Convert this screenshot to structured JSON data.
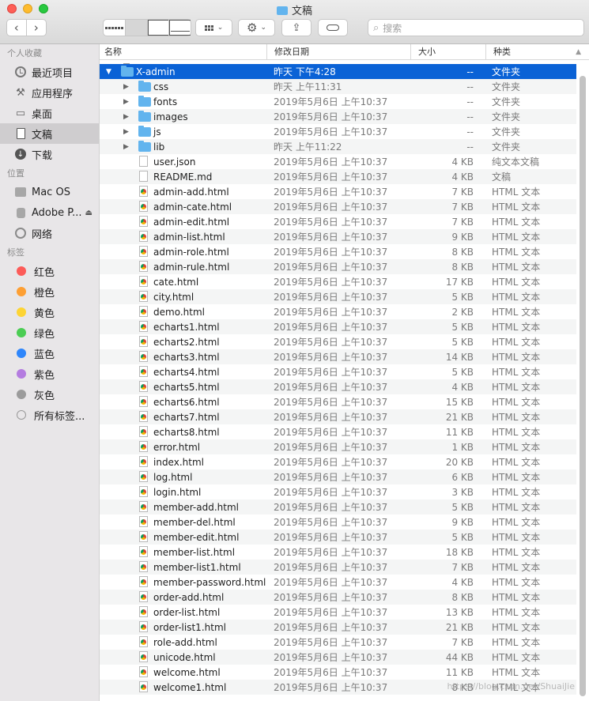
{
  "window": {
    "title": "文稿"
  },
  "toolbar": {
    "search_placeholder": "搜索"
  },
  "sidebar": {
    "sections": [
      {
        "title": "个人收藏",
        "items": [
          {
            "label": "最近项目",
            "icon": "recents-clock-icon"
          },
          {
            "label": "应用程序",
            "icon": "applications-icon"
          },
          {
            "label": "桌面",
            "icon": "desktop-icon"
          },
          {
            "label": "文稿",
            "icon": "documents-icon",
            "selected": true
          },
          {
            "label": "下载",
            "icon": "downloads-icon"
          }
        ]
      },
      {
        "title": "位置",
        "items": [
          {
            "label": "Mac OS",
            "icon": "hard-disk-icon"
          },
          {
            "label": "Adobe P...",
            "icon": "external-disk-icon"
          },
          {
            "label": "网络",
            "icon": "network-globe-icon"
          }
        ]
      },
      {
        "title": "标签",
        "items": [
          {
            "label": "红色",
            "color": "#fc5b58"
          },
          {
            "label": "橙色",
            "color": "#fd9f33"
          },
          {
            "label": "黄色",
            "color": "#fdd434"
          },
          {
            "label": "绿色",
            "color": "#4bcd53"
          },
          {
            "label": "蓝色",
            "color": "#2e86fb"
          },
          {
            "label": "紫色",
            "color": "#b47ce0"
          },
          {
            "label": "灰色",
            "color": "#9b9b9b"
          },
          {
            "label": "所有标签...",
            "color": ""
          }
        ]
      }
    ]
  },
  "columns": {
    "name": "名称",
    "date": "修改日期",
    "size": "大小",
    "kind": "种类"
  },
  "files": [
    {
      "name": "X-admin",
      "date": "昨天 下午4:28",
      "size": "--",
      "kind": "文件夹",
      "type": "folder",
      "level": 0,
      "expanded": true,
      "selected": true
    },
    {
      "name": "css",
      "date": "昨天 上午11:31",
      "size": "--",
      "kind": "文件夹",
      "type": "folder",
      "level": 1
    },
    {
      "name": "fonts",
      "date": "2019年5月6日 上午10:37",
      "size": "--",
      "kind": "文件夹",
      "type": "folder",
      "level": 1
    },
    {
      "name": "images",
      "date": "2019年5月6日 上午10:37",
      "size": "--",
      "kind": "文件夹",
      "type": "folder",
      "level": 1
    },
    {
      "name": "js",
      "date": "2019年5月6日 上午10:37",
      "size": "--",
      "kind": "文件夹",
      "type": "folder",
      "level": 1
    },
    {
      "name": "lib",
      "date": "昨天 上午11:22",
      "size": "--",
      "kind": "文件夹",
      "type": "folder",
      "level": 1
    },
    {
      "name": "user.json",
      "date": "2019年5月6日 上午10:37",
      "size": "4 KB",
      "kind": "纯文本文稿",
      "type": "file",
      "level": 1
    },
    {
      "name": "README.md",
      "date": "2019年5月6日 上午10:37",
      "size": "4 KB",
      "kind": "文稿",
      "type": "file",
      "level": 1
    },
    {
      "name": "admin-add.html",
      "date": "2019年5月6日 上午10:37",
      "size": "7 KB",
      "kind": "HTML 文本",
      "type": "html",
      "level": 1
    },
    {
      "name": "admin-cate.html",
      "date": "2019年5月6日 上午10:37",
      "size": "7 KB",
      "kind": "HTML 文本",
      "type": "html",
      "level": 1
    },
    {
      "name": "admin-edit.html",
      "date": "2019年5月6日 上午10:37",
      "size": "7 KB",
      "kind": "HTML 文本",
      "type": "html",
      "level": 1
    },
    {
      "name": "admin-list.html",
      "date": "2019年5月6日 上午10:37",
      "size": "9 KB",
      "kind": "HTML 文本",
      "type": "html",
      "level": 1
    },
    {
      "name": "admin-role.html",
      "date": "2019年5月6日 上午10:37",
      "size": "8 KB",
      "kind": "HTML 文本",
      "type": "html",
      "level": 1
    },
    {
      "name": "admin-rule.html",
      "date": "2019年5月6日 上午10:37",
      "size": "8 KB",
      "kind": "HTML 文本",
      "type": "html",
      "level": 1
    },
    {
      "name": "cate.html",
      "date": "2019年5月6日 上午10:37",
      "size": "17 KB",
      "kind": "HTML 文本",
      "type": "html",
      "level": 1
    },
    {
      "name": "city.html",
      "date": "2019年5月6日 上午10:37",
      "size": "5 KB",
      "kind": "HTML 文本",
      "type": "html",
      "level": 1
    },
    {
      "name": "demo.html",
      "date": "2019年5月6日 上午10:37",
      "size": "2 KB",
      "kind": "HTML 文本",
      "type": "html",
      "level": 1
    },
    {
      "name": "echarts1.html",
      "date": "2019年5月6日 上午10:37",
      "size": "5 KB",
      "kind": "HTML 文本",
      "type": "html",
      "level": 1
    },
    {
      "name": "echarts2.html",
      "date": "2019年5月6日 上午10:37",
      "size": "5 KB",
      "kind": "HTML 文本",
      "type": "html",
      "level": 1
    },
    {
      "name": "echarts3.html",
      "date": "2019年5月6日 上午10:37",
      "size": "14 KB",
      "kind": "HTML 文本",
      "type": "html",
      "level": 1
    },
    {
      "name": "echarts4.html",
      "date": "2019年5月6日 上午10:37",
      "size": "5 KB",
      "kind": "HTML 文本",
      "type": "html",
      "level": 1
    },
    {
      "name": "echarts5.html",
      "date": "2019年5月6日 上午10:37",
      "size": "4 KB",
      "kind": "HTML 文本",
      "type": "html",
      "level": 1
    },
    {
      "name": "echarts6.html",
      "date": "2019年5月6日 上午10:37",
      "size": "15 KB",
      "kind": "HTML 文本",
      "type": "html",
      "level": 1
    },
    {
      "name": "echarts7.html",
      "date": "2019年5月6日 上午10:37",
      "size": "21 KB",
      "kind": "HTML 文本",
      "type": "html",
      "level": 1
    },
    {
      "name": "echarts8.html",
      "date": "2019年5月6日 上午10:37",
      "size": "11 KB",
      "kind": "HTML 文本",
      "type": "html",
      "level": 1
    },
    {
      "name": "error.html",
      "date": "2019年5月6日 上午10:37",
      "size": "1 KB",
      "kind": "HTML 文本",
      "type": "html",
      "level": 1
    },
    {
      "name": "index.html",
      "date": "2019年5月6日 上午10:37",
      "size": "20 KB",
      "kind": "HTML 文本",
      "type": "html",
      "level": 1
    },
    {
      "name": "log.html",
      "date": "2019年5月6日 上午10:37",
      "size": "6 KB",
      "kind": "HTML 文本",
      "type": "html",
      "level": 1
    },
    {
      "name": "login.html",
      "date": "2019年5月6日 上午10:37",
      "size": "3 KB",
      "kind": "HTML 文本",
      "type": "html",
      "level": 1
    },
    {
      "name": "member-add.html",
      "date": "2019年5月6日 上午10:37",
      "size": "5 KB",
      "kind": "HTML 文本",
      "type": "html",
      "level": 1
    },
    {
      "name": "member-del.html",
      "date": "2019年5月6日 上午10:37",
      "size": "9 KB",
      "kind": "HTML 文本",
      "type": "html",
      "level": 1
    },
    {
      "name": "member-edit.html",
      "date": "2019年5月6日 上午10:37",
      "size": "5 KB",
      "kind": "HTML 文本",
      "type": "html",
      "level": 1
    },
    {
      "name": "member-list.html",
      "date": "2019年5月6日 上午10:37",
      "size": "18 KB",
      "kind": "HTML 文本",
      "type": "html",
      "level": 1
    },
    {
      "name": "member-list1.html",
      "date": "2019年5月6日 上午10:37",
      "size": "7 KB",
      "kind": "HTML 文本",
      "type": "html",
      "level": 1
    },
    {
      "name": "member-password.html",
      "date": "2019年5月6日 上午10:37",
      "size": "4 KB",
      "kind": "HTML 文本",
      "type": "html",
      "level": 1
    },
    {
      "name": "order-add.html",
      "date": "2019年5月6日 上午10:37",
      "size": "8 KB",
      "kind": "HTML 文本",
      "type": "html",
      "level": 1
    },
    {
      "name": "order-list.html",
      "date": "2019年5月6日 上午10:37",
      "size": "13 KB",
      "kind": "HTML 文本",
      "type": "html",
      "level": 1
    },
    {
      "name": "order-list1.html",
      "date": "2019年5月6日 上午10:37",
      "size": "21 KB",
      "kind": "HTML 文本",
      "type": "html",
      "level": 1
    },
    {
      "name": "role-add.html",
      "date": "2019年5月6日 上午10:37",
      "size": "7 KB",
      "kind": "HTML 文本",
      "type": "html",
      "level": 1
    },
    {
      "name": "unicode.html",
      "date": "2019年5月6日 上午10:37",
      "size": "44 KB",
      "kind": "HTML 文本",
      "type": "html",
      "level": 1
    },
    {
      "name": "welcome.html",
      "date": "2019年5月6日 上午10:37",
      "size": "11 KB",
      "kind": "HTML 文本",
      "type": "html",
      "level": 1
    },
    {
      "name": "welcome1.html",
      "date": "2019年5月6日 上午10:37",
      "size": "8 KB",
      "kind": "HTML 文本",
      "type": "html",
      "level": 1
    }
  ],
  "watermark": "https://blog.csdn.net/ShuaiJie"
}
